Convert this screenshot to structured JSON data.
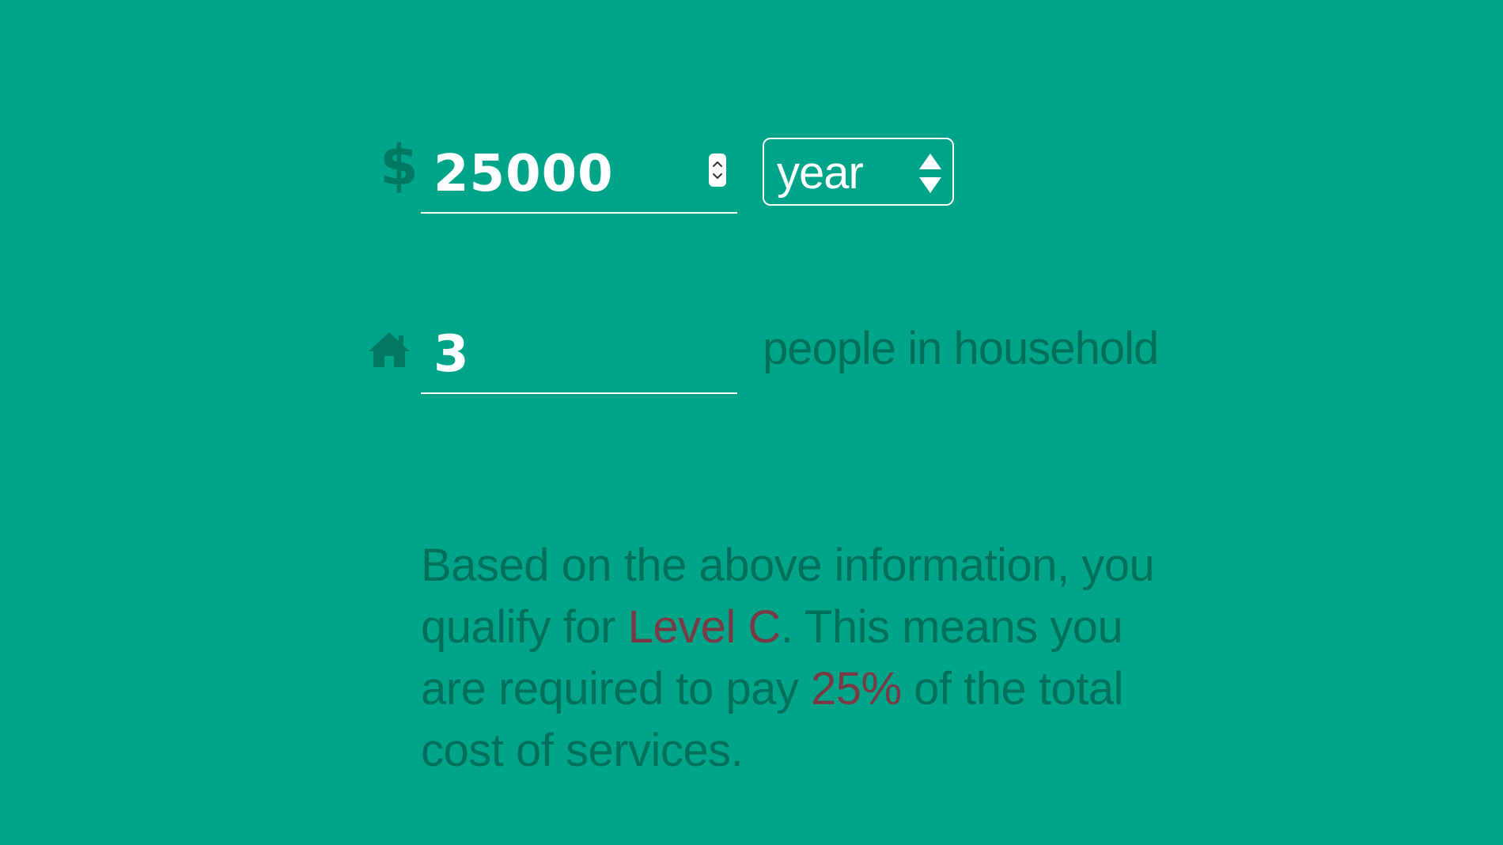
{
  "income": {
    "currency_icon": "dollar-icon",
    "currency_symbol": "$",
    "value": "25000",
    "period_options_selected": "year"
  },
  "household": {
    "icon": "house-icon",
    "value": "3",
    "label": "people in household"
  },
  "result": {
    "part1": "Based on the above information, you qualify for ",
    "level": "Level C",
    "part2": ". This means you are required to pay ",
    "percent": "25%",
    "part3": " of the total cost of services."
  },
  "colors": {
    "background": "#00a589",
    "accent_dark": "#00705b",
    "highlight": "#7a3a45",
    "input_text": "#ffffff"
  }
}
